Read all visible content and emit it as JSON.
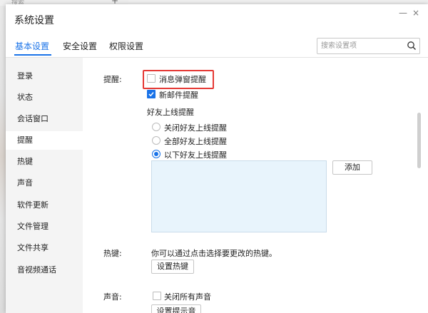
{
  "background": {
    "search_text": "搜索",
    "plus": "+"
  },
  "window": {
    "title": "系统设置",
    "minimize_symbol": "—",
    "close_symbol": "×"
  },
  "tabs": [
    {
      "label": "基本设置",
      "active": true
    },
    {
      "label": "安全设置",
      "active": false
    },
    {
      "label": "权限设置",
      "active": false
    }
  ],
  "search": {
    "placeholder": "搜索设置项",
    "value": ""
  },
  "sidebar": {
    "items": [
      {
        "label": "登录"
      },
      {
        "label": "状态"
      },
      {
        "label": "会话窗口"
      },
      {
        "label": "提醒",
        "active": true
      },
      {
        "label": "热键"
      },
      {
        "label": "声音"
      },
      {
        "label": "软件更新"
      },
      {
        "label": "文件管理"
      },
      {
        "label": "文件共享"
      },
      {
        "label": "音视频通话"
      }
    ]
  },
  "reminder": {
    "section_label": "提醒:",
    "popup_reminder": {
      "label": "消息弹窗提醒",
      "checked": false
    },
    "mail_reminder": {
      "label": "新邮件提醒",
      "checked": true
    },
    "friend_online_title": "好友上线提醒",
    "friend_options": [
      {
        "label": "关闭好友上线提醒",
        "selected": false
      },
      {
        "label": "全部好友上线提醒",
        "selected": false
      },
      {
        "label": "以下好友上线提醒",
        "selected": true
      }
    ],
    "add_button": "添加"
  },
  "hotkey": {
    "section_label": "热键:",
    "description": "你可以通过点击选择要更改的热键。",
    "button": "设置热键"
  },
  "sound": {
    "section_label": "声音:",
    "mute_all": {
      "label": "关闭所有声音",
      "checked": false
    },
    "button": "设置提示音"
  },
  "colors": {
    "accent": "#1a73e8",
    "highlight_border": "#e53935",
    "friend_list_bg": "#e8f4fc"
  }
}
